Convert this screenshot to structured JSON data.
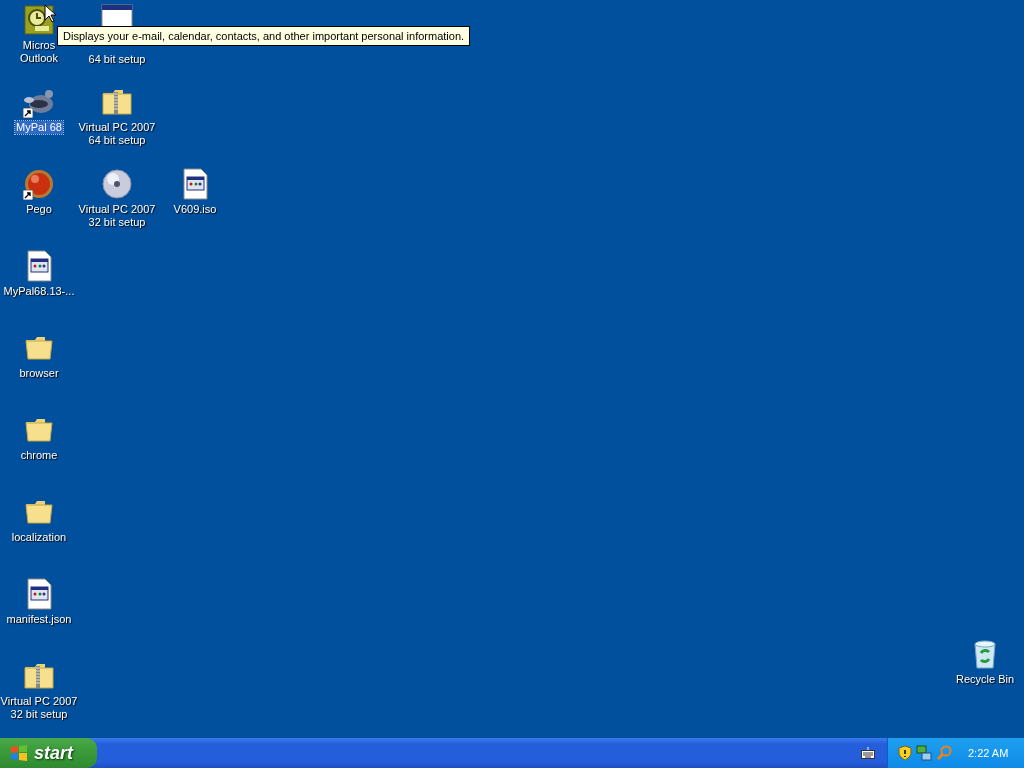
{
  "desktop": {
    "columns": [
      [
        {
          "kind": "outlook",
          "lines": [
            "Micros",
            "Outlook"
          ],
          "selected": false,
          "shortcut": false
        },
        {
          "kind": "raccoon",
          "lines": [
            "MyPal 68"
          ],
          "selected": true,
          "shortcut": true
        },
        {
          "kind": "pego",
          "lines": [
            "Pego"
          ],
          "selected": false,
          "shortcut": true
        },
        {
          "kind": "document",
          "lines": [
            "MyPal68.13-..."
          ],
          "selected": false,
          "shortcut": false
        },
        {
          "kind": "folder",
          "lines": [
            "browser"
          ],
          "selected": false,
          "shortcut": false
        },
        {
          "kind": "folder",
          "lines": [
            "chrome"
          ],
          "selected": false,
          "shortcut": false
        },
        {
          "kind": "folder",
          "lines": [
            "localization"
          ],
          "selected": false,
          "shortcut": false
        },
        {
          "kind": "document",
          "lines": [
            "manifest.json"
          ],
          "selected": false,
          "shortcut": false
        },
        {
          "kind": "zip",
          "lines": [
            "Virtual PC 2007",
            "32 bit setup"
          ],
          "selected": false,
          "shortcut": false
        }
      ],
      [
        {
          "kind": "window",
          "lines": [
            "64 bit setup"
          ],
          "selected": false,
          "shortcut": false,
          "first_line_hidden": true
        },
        {
          "kind": "zip",
          "lines": [
            "Virtual PC 2007",
            "64 bit setup"
          ],
          "selected": false,
          "shortcut": false
        },
        {
          "kind": "disc",
          "lines": [
            "Virtual PC 2007",
            "32 bit setup"
          ],
          "selected": false,
          "shortcut": false
        }
      ],
      [
        null,
        null,
        {
          "kind": "document",
          "lines": [
            "V609.iso"
          ],
          "selected": false,
          "shortcut": false
        }
      ]
    ],
    "recycle_bin": {
      "kind": "recycle",
      "lines": [
        "Recycle Bin"
      ],
      "selected": false,
      "shortcut": false
    }
  },
  "tooltip": "Displays your e-mail, calendar, contacts, and other important personal information.",
  "taskbar": {
    "start": "start",
    "tray": {
      "time": "2:22 AM"
    }
  }
}
